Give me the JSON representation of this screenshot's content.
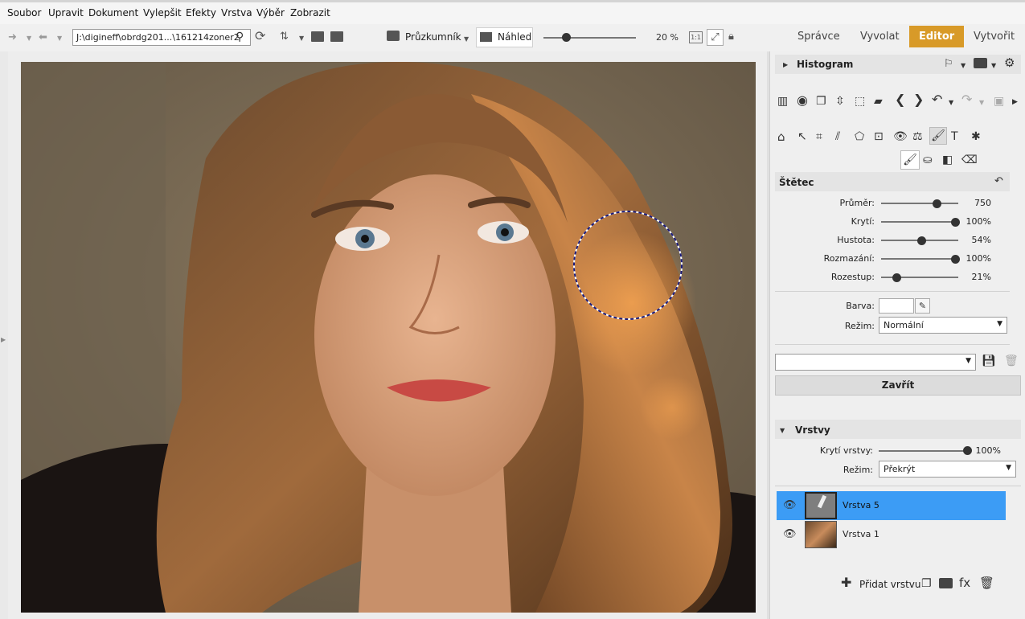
{
  "menu": [
    "Soubor",
    "Upravit",
    "Dokument",
    "Vylepšit",
    "Efekty",
    "Vrstva",
    "Výběr",
    "Zobrazit"
  ],
  "toolbar": {
    "path": "J:\\digineff\\obrdg201...\\161214zoner2",
    "explorer_label": "Průzkumník",
    "preview_label": "Náhled",
    "zoom": "20 %",
    "zoom_slider_fraction": 0.24,
    "one_to_one": "1:1"
  },
  "modes": {
    "manager": "Správce",
    "develop": "Vyvolat",
    "editor": "Editor",
    "create": "Vytvořit"
  },
  "accent_color": "#d89a28",
  "histogram": {
    "title": "Histogram"
  },
  "brush": {
    "title": "Štětec",
    "params": [
      {
        "label": "Průměr:",
        "value": "750",
        "fraction": 0.72
      },
      {
        "label": "Krytí:",
        "value": "100%",
        "fraction": 0.96
      },
      {
        "label": "Hustota:",
        "value": "54%",
        "fraction": 0.52
      },
      {
        "label": "Rozmazání:",
        "value": "100%",
        "fraction": 0.96
      },
      {
        "label": "Rozestup:",
        "value": "21%",
        "fraction": 0.2
      }
    ],
    "color_label": "Barva:",
    "mode_label": "Režim:",
    "mode_value": "Normální",
    "preset_value": "",
    "close_label": "Zavřít"
  },
  "layers": {
    "title": "Vrstvy",
    "opacity_label": "Krytí vrstvy:",
    "opacity_value": "100%",
    "opacity_fraction": 0.98,
    "mode_label": "Režim:",
    "mode_value": "Překrýt",
    "items": [
      {
        "name": "Vrstva 5",
        "selected": true
      },
      {
        "name": "Vrstva 1",
        "selected": false
      }
    ],
    "add_label": "Přidat vrstvu",
    "fx_label": "fx"
  },
  "selection_color": "#3c9cf5"
}
